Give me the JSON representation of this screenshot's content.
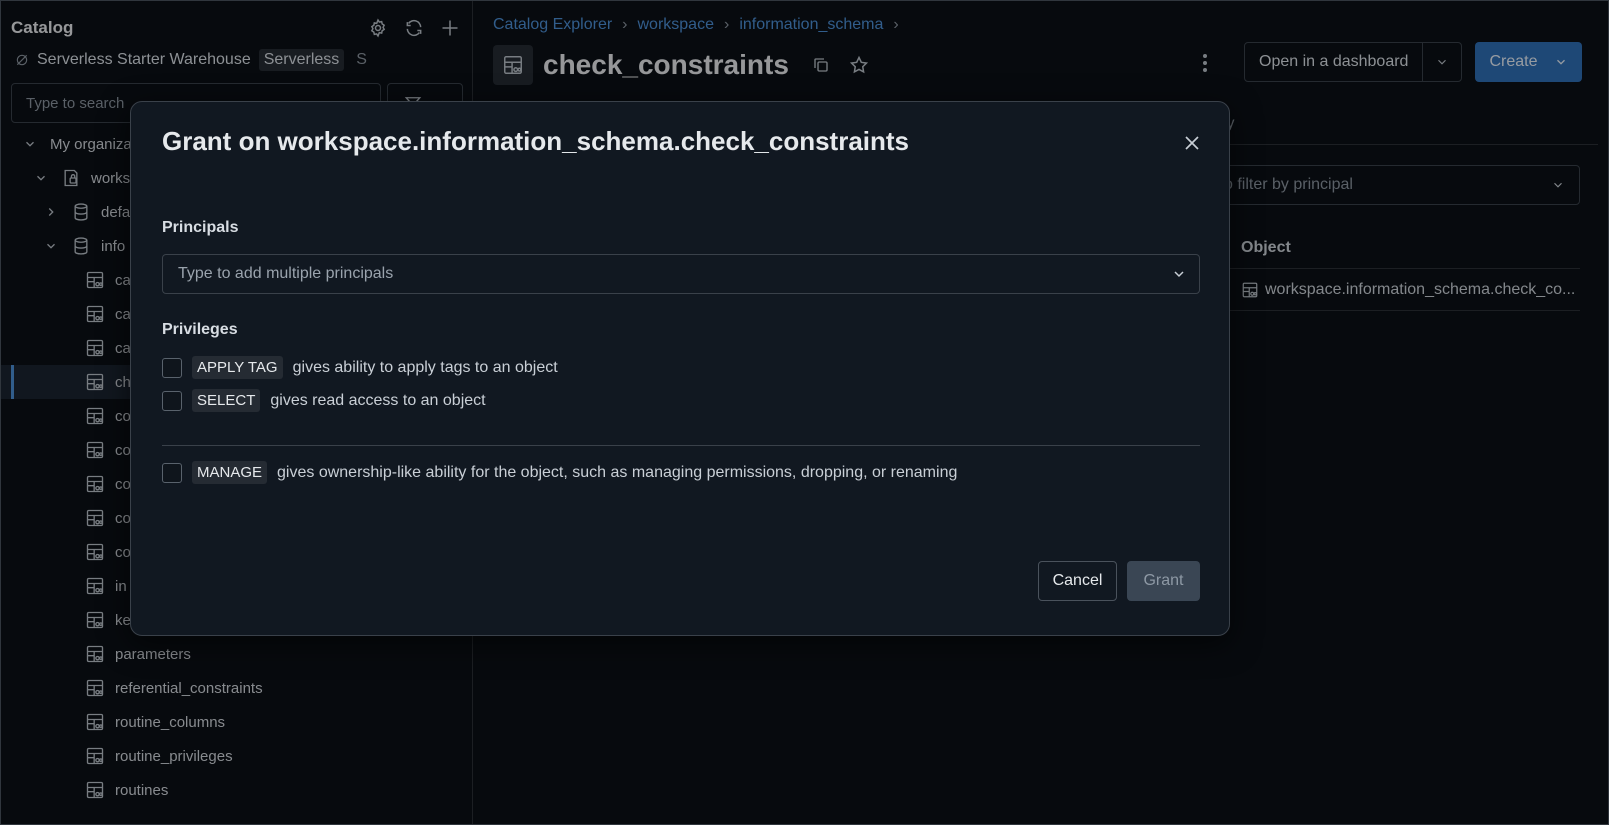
{
  "sidebar": {
    "title": "Catalog",
    "warehouse": {
      "name": "Serverless Starter Warehouse",
      "badge": "Serverless",
      "extra": "S"
    },
    "search_placeholder": "Type to search",
    "tree": [
      {
        "label": "My organiza",
        "level": 0,
        "chevron": "down",
        "icon": ""
      },
      {
        "label": "works",
        "level": 1,
        "chevron": "down",
        "icon": "catalog-icon"
      },
      {
        "label": "defa",
        "level": 2,
        "chevron": "right",
        "icon": "database-icon"
      },
      {
        "label": "info",
        "level": 2,
        "chevron": "down",
        "icon": "database-icon"
      },
      {
        "label": "ca",
        "level": 3,
        "icon": "table-icon"
      },
      {
        "label": "ca",
        "level": 3,
        "icon": "table-icon"
      },
      {
        "label": "ca",
        "level": 3,
        "icon": "table-icon"
      },
      {
        "label": "ch",
        "level": 3,
        "icon": "table-icon",
        "selected": true
      },
      {
        "label": "co",
        "level": 3,
        "icon": "table-icon"
      },
      {
        "label": "co",
        "level": 3,
        "icon": "table-icon"
      },
      {
        "label": "co",
        "level": 3,
        "icon": "table-icon"
      },
      {
        "label": "co",
        "level": 3,
        "icon": "table-icon"
      },
      {
        "label": "co",
        "level": 3,
        "icon": "table-icon"
      },
      {
        "label": "in",
        "level": 3,
        "icon": "table-icon"
      },
      {
        "label": "key_column_usage",
        "level": 3,
        "icon": "table-icon"
      },
      {
        "label": "parameters",
        "level": 3,
        "icon": "table-icon"
      },
      {
        "label": "referential_constraints",
        "level": 3,
        "icon": "table-icon"
      },
      {
        "label": "routine_columns",
        "level": 3,
        "icon": "table-icon"
      },
      {
        "label": "routine_privileges",
        "level": 3,
        "icon": "table-icon"
      },
      {
        "label": "routines",
        "level": 3,
        "icon": "table-icon"
      }
    ]
  },
  "main": {
    "breadcrumb": [
      "Catalog Explorer",
      "workspace",
      "information_schema"
    ],
    "title": "check_constraints",
    "open_dashboard_label": "Open in a dashboard",
    "create_label": "Create",
    "bg_tab": "ty",
    "bg_filter_placeholder": "o filter by principal",
    "bg_column": "Object",
    "bg_cell": "workspace.information_schema.check_co..."
  },
  "modal": {
    "title": "Grant on workspace.information_schema.check_constraints",
    "principals_label": "Principals",
    "principals_placeholder": "Type to add multiple principals",
    "privileges_label": "Privileges",
    "privileges": [
      {
        "tag": "APPLY TAG",
        "desc": "gives ability to apply tags to an object"
      },
      {
        "tag": "SELECT",
        "desc": "gives read access to an object"
      }
    ],
    "manage": {
      "tag": "MANAGE",
      "desc": "gives ownership-like ability for the object, such as managing permissions, dropping, or renaming"
    },
    "cancel_label": "Cancel",
    "grant_label": "Grant"
  },
  "colors": {
    "accent": "#4c8fd6",
    "primary_button": "#2f6fb6",
    "background": "#0b1016",
    "modal_background": "#111821"
  }
}
